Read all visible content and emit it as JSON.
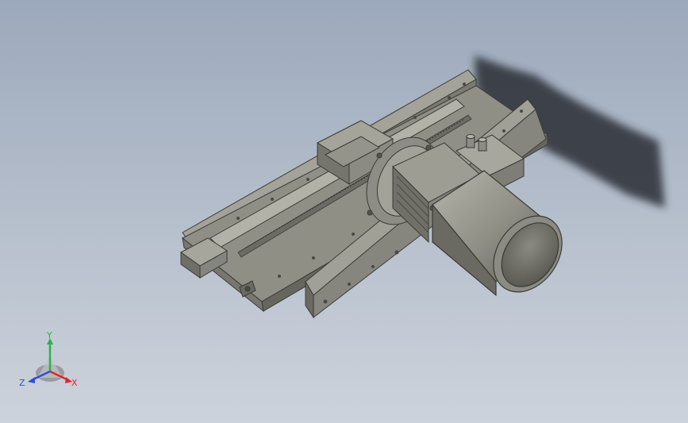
{
  "viewport": {
    "background_top": "#9ca9bc",
    "background_bottom": "#cdd3dc"
  },
  "model": {
    "kind": "linear-slide-module-with-motor",
    "part_color": "#8f8f86",
    "part_color_light": "#a9a9a0",
    "part_color_dark": "#5e5e58",
    "shadow_color": "#2c2f35"
  },
  "triad": {
    "x_label": "X",
    "y_label": "Y",
    "z_label": "Z",
    "x_color": "#e0262b",
    "y_color": "#27b34a",
    "z_color": "#2f4fd8"
  }
}
